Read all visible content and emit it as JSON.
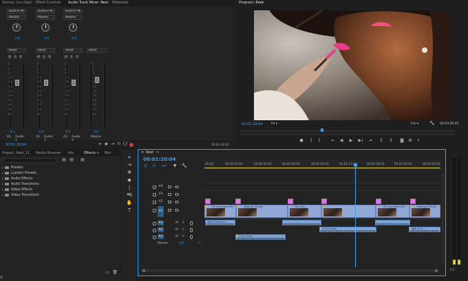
{
  "source_tabs": {
    "source": "Source: (no clips)",
    "effect_controls": "Effect Controls",
    "mixer": "Audio Track Mixer: Reel",
    "metadata": "Metadata"
  },
  "mixer": {
    "channels": [
      {
        "input": "Built-in M...",
        "output": "Master",
        "pan": "0.0",
        "mode": "Read",
        "level": "-2.1",
        "id": "A1",
        "name": "Audio 1"
      },
      {
        "input": "Built-in M...",
        "output": "Master",
        "pan": "0.0",
        "mode": "Read",
        "level": "-1.0",
        "id": "A2",
        "name": "Audio 2"
      },
      {
        "input": "Built-in M...",
        "output": "Master",
        "pan": "0.0",
        "mode": "Read",
        "level": "0.0",
        "id": "A3",
        "name": "Audio 3"
      }
    ],
    "master": {
      "mode": "Read",
      "level": "0.0",
      "name": "Master"
    },
    "mute_label": "M",
    "solo_label": "S",
    "record_label": "R",
    "db_ticks": [
      "6",
      "0",
      "-6",
      "-12",
      "-18",
      "-24",
      "-30",
      "-36",
      "-42",
      "-48",
      "-54",
      "dB"
    ],
    "timecode_left": "00:01:20:04",
    "timecode_right": "00:03:36:01"
  },
  "program": {
    "tab": "Program: Reel",
    "timecode": "00:01:20:04",
    "fit": "Fit",
    "quality": "Full",
    "duration": "00:03:36:01"
  },
  "project": {
    "tabs": [
      "Project: Reel_11",
      "Media Browser",
      "Info",
      "Effects",
      "Mar"
    ],
    "active_tab": "Effects",
    "effects": [
      "Presets",
      "Lumetri Presets",
      "Audio Effects",
      "Audio Transitions",
      "Video Effects",
      "Video Transitions"
    ]
  },
  "timeline": {
    "tab": "Reel",
    "timecode": "00:01:20:04",
    "ruler": [
      "00:00",
      "00:00:15:00",
      "00:00:30:00",
      "00:00:45:00",
      "00:01:00:00",
      "00:01:15:00",
      "00:01:30:00",
      "00:01:45:00",
      "00:02:00:00"
    ],
    "video_tracks": [
      "V4",
      "V3",
      "V2",
      "V1"
    ],
    "audio_tracks": [
      "A1",
      "A2",
      "A3"
    ],
    "master_label": "Master",
    "master_value": "0.0",
    "clip_labels": [
      "Pe Liberatore Wh..",
      "Makeup 1P.mov",
      "Pe Libe...",
      "Pe Liberatore Wh..",
      "Makeup 1P.mov"
    ],
    "audio_clip_labels": [
      "Reel 2Good pe...",
      "01 Rvl Show",
      "01 Rvl Show",
      "Reel_11 2..."
    ]
  },
  "colors": {
    "accent": "#3f9ef0",
    "video_clip": "#92a9d6",
    "audio_clip": "#7ea5d8",
    "pink_clip": "#d67bd6",
    "playhead": "#3f9ef0",
    "work_area": "#e8df3c"
  }
}
